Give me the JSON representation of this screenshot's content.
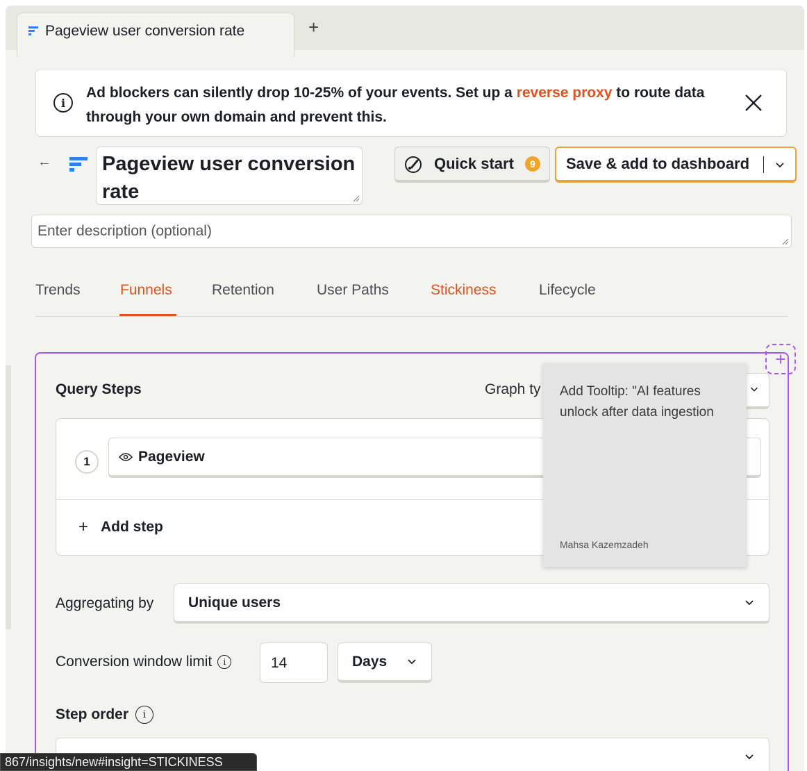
{
  "tab": {
    "title": "Pageview user conversion rate",
    "add_label": "+"
  },
  "banner": {
    "text_before": "Ad blockers can silently drop 10-25% of your events. Set up a ",
    "link_text": "reverse proxy",
    "text_after": " to route data through your own domain and prevent this."
  },
  "header": {
    "back_label": "←",
    "title_value": "Pageview user conversion rate",
    "quick_start_label": "Quick start",
    "quick_start_badge": "9",
    "save_label": "Save & add to dashboard"
  },
  "description": {
    "placeholder": "Enter description (optional)"
  },
  "insight_tabs": [
    {
      "label": "Trends"
    },
    {
      "label": "Funnels"
    },
    {
      "label": "Retention"
    },
    {
      "label": "User Paths"
    },
    {
      "label": "Stickiness"
    },
    {
      "label": "Lifecycle"
    }
  ],
  "query": {
    "title": "Query Steps",
    "graph_type_label": "Graph ty",
    "steps": [
      {
        "number": "1",
        "event": "Pageview"
      }
    ],
    "add_step_label": "Add step",
    "aggregating_label": "Aggregating by",
    "aggregating_value": "Unique users",
    "conversion_window_label": "Conversion window limit",
    "conversion_window_value": "14",
    "conversion_window_unit": "Days",
    "step_order_label": "Step order"
  },
  "tooltip_note": {
    "text": "Add Tooltip: \"AI features unlock after data ingestion",
    "author": "Mahsa Kazemzadeh",
    "add_marker": "+"
  },
  "status_url": "867/insights/new#insight=STICKINESS",
  "colors": {
    "accent": "#e0521f",
    "highlight": "#a855f7",
    "save_border": "#e8a33d",
    "badge": "#f0a52a"
  }
}
